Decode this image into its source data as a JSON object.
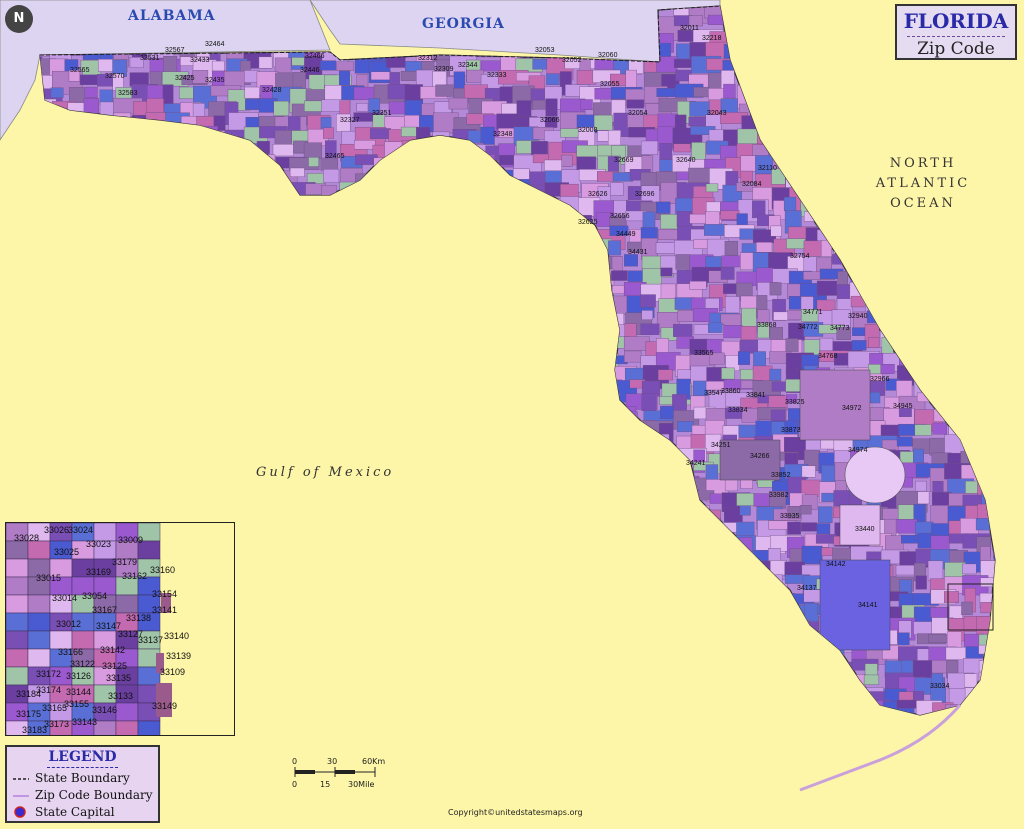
{
  "title": {
    "main": "FLORIDA",
    "sub": "Zip Code"
  },
  "north_arrow": "N",
  "state_labels": {
    "alabama": "ALABAMA",
    "georgia": "GEORGIA"
  },
  "water_labels": {
    "ocean_line1": "NORTH",
    "ocean_line2": "ATLANTIC",
    "ocean_line3": "OCEAN",
    "gulf": "Gulf of Mexico"
  },
  "legend": {
    "title": "LEGEND",
    "items": [
      {
        "label": "State Boundary",
        "symbol": "dashed-line-icon"
      },
      {
        "label": "Zip Code Boundary",
        "symbol": "thin-line-icon"
      },
      {
        "label": "State Capital",
        "symbol": "capital-dot-icon"
      }
    ]
  },
  "scale": {
    "km_ticks": [
      "0",
      "30",
      "60Km"
    ],
    "mile_ticks": [
      "0",
      "15",
      "30Mile"
    ]
  },
  "copyright": "Copyright©unitedstatesmaps.org",
  "colors": {
    "land_other": "#fdf6a8",
    "neighbor_states": "#dcd4f0",
    "title_text": "#2a2aa8",
    "state_label": "#2a4ab0",
    "zip_palette": [
      "#9b59d0",
      "#c49ae6",
      "#7a4fb5",
      "#d99be0",
      "#5a6fd6",
      "#b07cc6",
      "#8c6aa8",
      "#e0b8f0",
      "#6b3fa0",
      "#a0c4a8",
      "#c46ab0",
      "#4a5ad0"
    ]
  },
  "zip_labels": [
    "32531",
    "32567",
    "32464",
    "32433",
    "32425",
    "32446",
    "32466",
    "32428",
    "32435",
    "32570",
    "32583",
    "32565",
    "32312",
    "32309",
    "32344",
    "32333",
    "32053",
    "32052",
    "32060",
    "32055",
    "32011",
    "32218",
    "32043",
    "32327",
    "32351",
    "32465",
    "32348",
    "32066",
    "32008",
    "32054",
    "32640",
    "32110",
    "32084",
    "32669",
    "32626",
    "32696",
    "32625",
    "34449",
    "34431",
    "32754",
    "34771",
    "34772",
    "34773",
    "34768",
    "32940",
    "34972",
    "32966",
    "34945",
    "34974",
    "34266",
    "33852",
    "33982",
    "33935",
    "33440",
    "34142",
    "34141",
    "34251",
    "34241",
    "33873",
    "33834",
    "33825",
    "33841",
    "33547",
    "33860",
    "33565",
    "33868",
    "32656",
    "33034",
    "34137"
  ],
  "inset_zip_labels": [
    "33028",
    "33026",
    "33024",
    "33025",
    "33023",
    "33009",
    "33179",
    "33015",
    "33169",
    "33162",
    "33160",
    "33054",
    "33014",
    "33167",
    "33154",
    "33141",
    "33012",
    "33138",
    "33147",
    "33127",
    "33137",
    "33140",
    "33166",
    "33142",
    "33139",
    "33122",
    "33125",
    "33109",
    "33172",
    "33174",
    "33126",
    "33144",
    "33135",
    "33184",
    "33165",
    "33155",
    "33133",
    "33175",
    "33146",
    "33149",
    "33183",
    "33173",
    "33143"
  ]
}
